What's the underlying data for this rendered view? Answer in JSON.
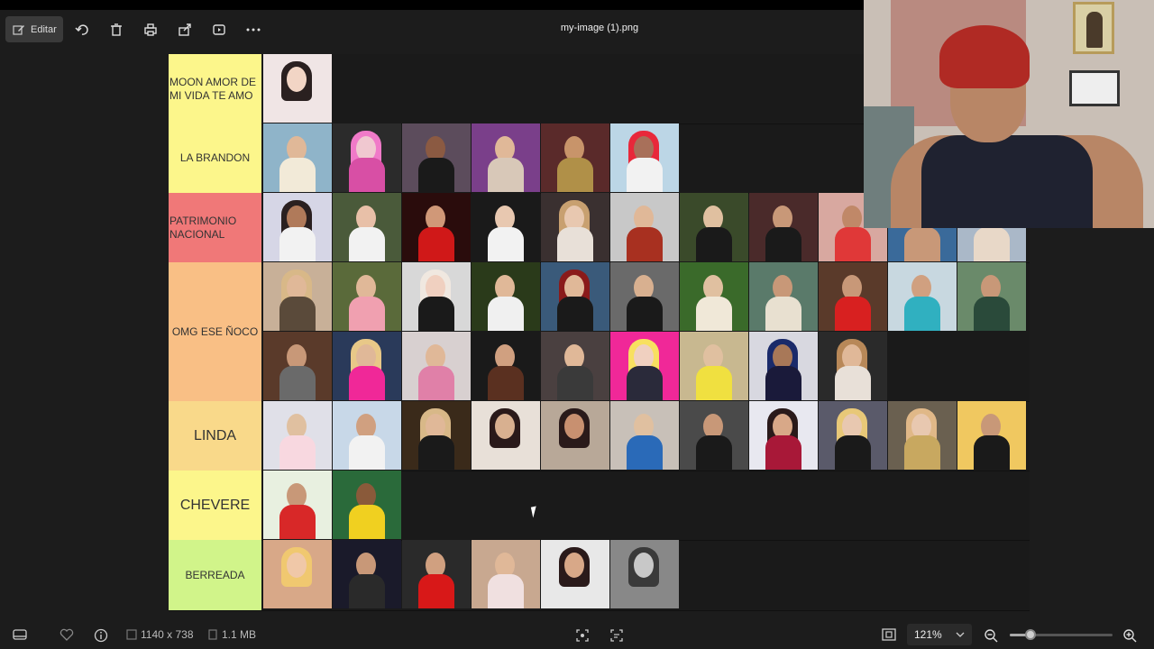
{
  "toolbar": {
    "edit_label": "Editar",
    "title": "my-image (1).png",
    "icons": [
      "rotate-icon",
      "delete-icon",
      "print-icon",
      "share-icon",
      "slideshow-icon",
      "more-icon"
    ]
  },
  "tiers": [
    {
      "label": "MOON AMOR DE MI VIDA TE AMO",
      "color": "#fcf68b",
      "count": 1
    },
    {
      "label": "LA BRANDON",
      "color": "#fcf68b",
      "count": 6
    },
    {
      "label": "PATRIMONIO NACIONAL",
      "color": "#f07878",
      "count": 11
    },
    {
      "label": "OMG ESE ÑOCO",
      "color": "#f9bf85",
      "count": 20
    },
    {
      "label": "LINDA",
      "color": "#f9d98a",
      "count": 11
    },
    {
      "label": "CHEVERE",
      "color": "#fcf68b",
      "count": 2
    },
    {
      "label": "BERREADA",
      "color": "#d1f48a",
      "count": 6
    }
  ],
  "status": {
    "dimensions": "1140 x 738",
    "size": "1.1 MB",
    "zoom": "121%",
    "zoom_fraction": 0.2
  },
  "colors": {
    "background": "#1c1c1c",
    "tier_bg": "#1a1a1a"
  }
}
